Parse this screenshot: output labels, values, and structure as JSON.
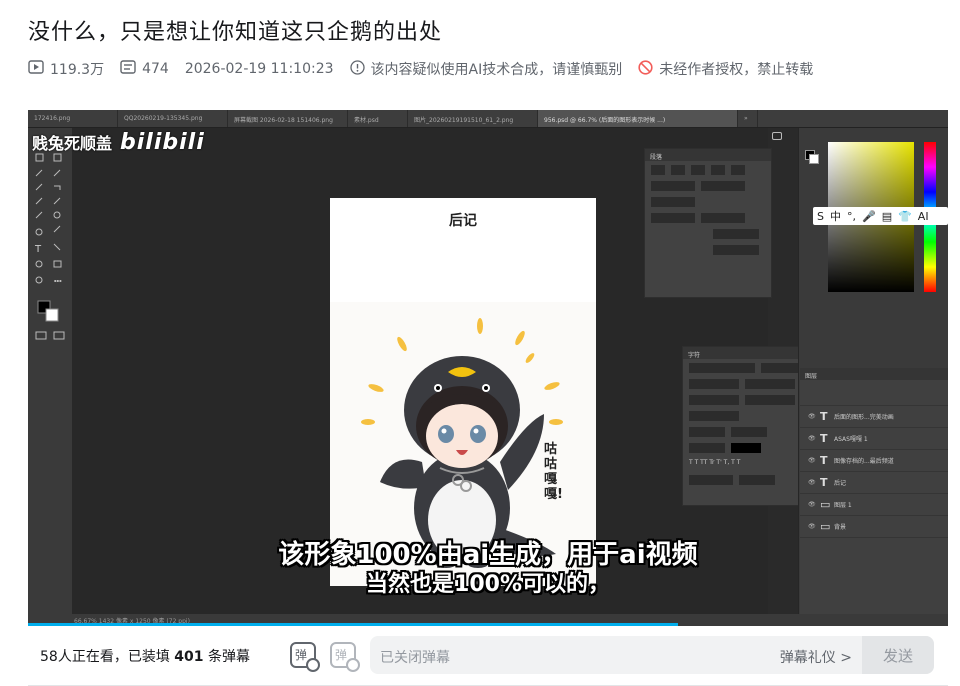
{
  "video": {
    "title": "没什么，只是想让你知道这只企鹅的出处",
    "views": "119.3万",
    "danmaku_count": "474",
    "publish_time": "2026-02-19 11:10:23",
    "ai_notice": "该内容疑似使用AI技术合成，请谨慎甄别",
    "copyright_notice": "未经作者授权，禁止转载"
  },
  "player": {
    "watermark_text": "贱兔死顺盖",
    "watermark_logo": "bilibili",
    "doc_title": "后记",
    "bubble_text": "咕咕嘎嘎!",
    "subtitle_line1": "该形象100%由ai生成，用于ai视频",
    "subtitle_line2": "当然也是100%可以的，",
    "progress": 0.707,
    "ps_tabs": [
      "172416.png",
      "QQ20260219-135345.png",
      "屏幕截图 2026-02-18 151406.png",
      "素材.psd",
      "图片_20260219191510_61_2.png",
      "956.psd @ 66.7% (后面的图形表示时候 ...)",
      "»"
    ],
    "ps_status": "66.67%    1432 像素 x 1250 像素 (72 ppi)",
    "ime_strip": [
      "S",
      "中",
      "°,",
      "🎤",
      "▤",
      "👕",
      "AI"
    ],
    "layers": [
      {
        "type": "T",
        "name": "后面的图形...完美动画"
      },
      {
        "type": "T",
        "name": "ASAS嘎嘎 1"
      },
      {
        "type": "T",
        "name": "图像存档的...最后频道"
      },
      {
        "type": "T",
        "name": "后记"
      },
      {
        "type": "img",
        "name": "图层 1"
      },
      {
        "type": "bg",
        "name": "背景"
      }
    ]
  },
  "danmaku_bar": {
    "watching_prefix": "58人正在看，已装填",
    "filled_count": "401",
    "watching_suffix": "条弹幕",
    "input_placeholder": "已关闭弹幕",
    "etiquette": "弹幕礼仪 >",
    "send_label": "发送"
  },
  "colors": {
    "accent": "#00aeec",
    "title": "#18191c",
    "meta": "#61666d"
  }
}
